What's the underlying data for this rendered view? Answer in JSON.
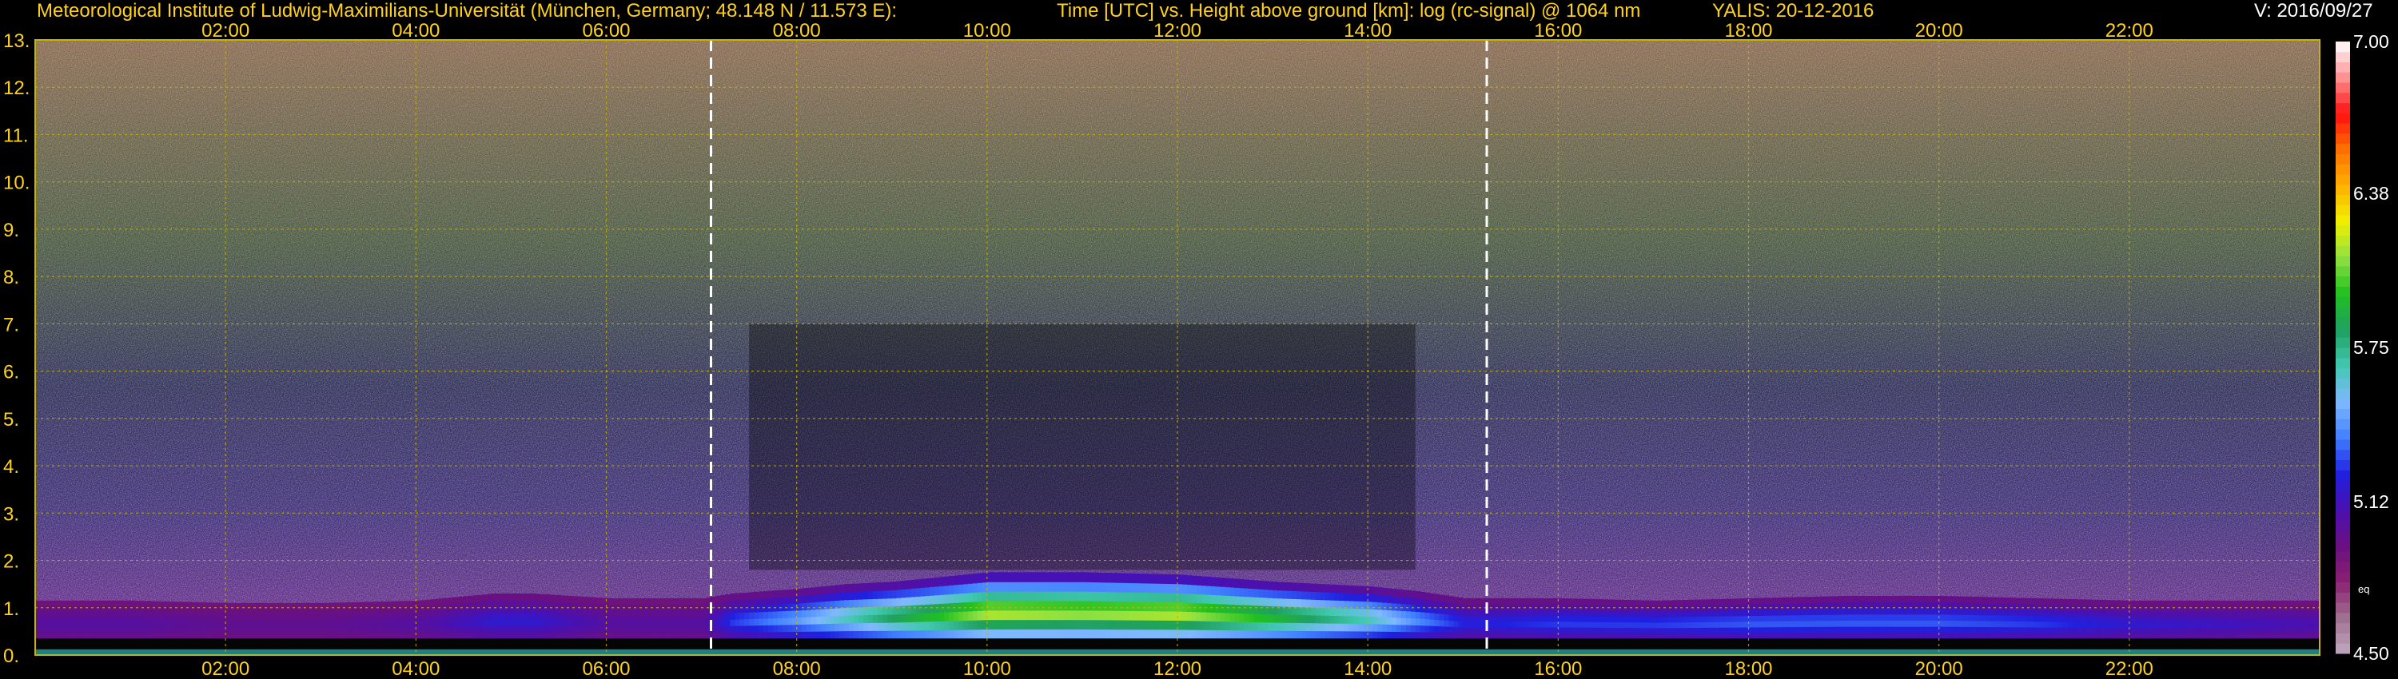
{
  "header": {
    "institute": "Meteorological Institute of Ludwig-Maximilians-Universität (München, Germany; 48.148 N / 11.573 E):",
    "plot_description": "Time [UTC] vs. Height above ground [km]: log (rc-signal) @ 1064 nm",
    "instrument_date": "YALIS: 20-12-2016",
    "version": "V: 2016/09/27"
  },
  "colors": {
    "background": "#000000",
    "text_yellow": "#ffd21a",
    "text_white": "#ffffff",
    "grid": "#c8b400",
    "marker_line": "#ffffff"
  },
  "chart_data": {
    "type": "heatmap",
    "title": "Time [UTC] vs. Height above ground [km]: log (rc-signal) @ 1064 nm",
    "xlabel": "Time [UTC]",
    "ylabel": "Height above ground [km]",
    "x_unit": "hours UTC",
    "xlim": [
      0.0,
      24.0
    ],
    "ylim": [
      0,
      13
    ],
    "x_ticks": [
      2,
      4,
      6,
      8,
      10,
      12,
      14,
      16,
      18,
      20,
      22
    ],
    "x_tick_labels": [
      "02:00",
      "04:00",
      "06:00",
      "08:00",
      "10:00",
      "12:00",
      "14:00",
      "16:00",
      "18:00",
      "20:00",
      "22:00"
    ],
    "y_ticks": [
      0,
      1,
      2,
      3,
      4,
      5,
      6,
      7,
      8,
      9,
      10,
      11,
      12,
      13
    ],
    "y_tick_labels": [
      "0.",
      "1.",
      "2.",
      "3.",
      "4.",
      "5.",
      "6.",
      "7.",
      "8.",
      "9.",
      "10.",
      "11.",
      "12.",
      "13."
    ],
    "grid": true,
    "colorbar": {
      "range": [
        4.5,
        7.0
      ],
      "tick_values": [
        4.5,
        5.12,
        5.75,
        6.38,
        7.0
      ],
      "tick_labels": [
        "4.50",
        "5.12",
        "5.75",
        "6.38",
        "7.00"
      ],
      "extra_label": "eq",
      "stops": [
        "#c0a8c0",
        "#a07090",
        "#8a2070",
        "#6a1080",
        "#4a10b0",
        "#2020e0",
        "#4080ff",
        "#80b8ff",
        "#40c8b0",
        "#20a060",
        "#20c020",
        "#90e040",
        "#f0f000",
        "#ffb000",
        "#ff7000",
        "#ff1010",
        "#ff9090",
        "#ffffff"
      ]
    },
    "vertical_markers_time": [
      7.1,
      15.25
    ],
    "layers": {
      "noise_zone_km": [
        1.8,
        13
      ],
      "boundary_layer": {
        "time": [
          0.0,
          1.0,
          2.0,
          3.0,
          4.0,
          4.8,
          5.2,
          6.0,
          7.0,
          7.3,
          8.0,
          8.5,
          9.0,
          9.5,
          10.0,
          11.0,
          12.0,
          13.0,
          14.0,
          14.5,
          15.0,
          15.3,
          16.0,
          17.0,
          18.0,
          19.0,
          20.0,
          21.0,
          22.0,
          23.0,
          24.0
        ],
        "top_km": [
          1.15,
          1.15,
          1.1,
          1.1,
          1.15,
          1.3,
          1.3,
          1.2,
          1.2,
          1.3,
          1.4,
          1.5,
          1.55,
          1.65,
          1.75,
          1.75,
          1.7,
          1.55,
          1.45,
          1.35,
          1.2,
          1.2,
          1.2,
          1.15,
          1.2,
          1.25,
          1.25,
          1.2,
          1.15,
          1.15,
          1.15
        ],
        "log_signal": [
          5.05,
          5.05,
          5.0,
          5.0,
          5.05,
          5.2,
          5.2,
          5.05,
          5.05,
          5.3,
          5.5,
          5.7,
          5.9,
          6.05,
          6.25,
          6.2,
          6.25,
          6.0,
          5.7,
          5.45,
          5.25,
          5.25,
          5.3,
          5.3,
          5.35,
          5.35,
          5.35,
          5.3,
          5.2,
          5.15,
          5.1
        ]
      },
      "surface_layer_km": [
        0,
        0.35
      ]
    }
  }
}
